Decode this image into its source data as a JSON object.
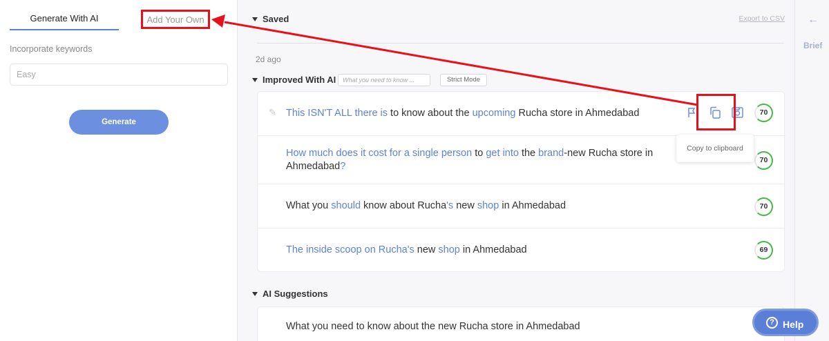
{
  "left_panel": {
    "tabs": [
      {
        "label": "Generate With AI"
      },
      {
        "label": "Add Your Own"
      }
    ],
    "keywords_label": "Incorporate keywords",
    "keywords_placeholder": "Easy",
    "generate_label": "Generate"
  },
  "saved": {
    "heading": "Saved",
    "export_label": "Export to CSV",
    "time_ago": "2d ago"
  },
  "improved": {
    "heading": "Improved With AI",
    "input_placeholder": "What you need to know ...",
    "strict_label": "Strict Mode",
    "rows": [
      {
        "parts": [
          {
            "t": "This ISN'T ALL there is",
            "hl": true
          },
          {
            "t": " to know about the ",
            "hl": false
          },
          {
            "t": "upcoming",
            "hl": true
          },
          {
            "t": " Rucha store in Ahmedabad",
            "hl": false
          }
        ],
        "score": "70"
      },
      {
        "parts": [
          {
            "t": "How much does it cost for a single person",
            "hl": true
          },
          {
            "t": " to ",
            "hl": false
          },
          {
            "t": "get into",
            "hl": true
          },
          {
            "t": " the ",
            "hl": false
          },
          {
            "t": "brand",
            "hl": true
          },
          {
            "t": "-new Rucha store in Ahmedabad",
            "hl": false
          },
          {
            "t": "?",
            "hl": true
          }
        ],
        "score": "70"
      },
      {
        "parts": [
          {
            "t": "What you ",
            "hl": false
          },
          {
            "t": "should",
            "hl": true
          },
          {
            "t": " know about Rucha",
            "hl": false
          },
          {
            "t": "'s",
            "hl": true
          },
          {
            "t": " new ",
            "hl": false
          },
          {
            "t": "shop",
            "hl": true
          },
          {
            "t": " in Ahmedabad",
            "hl": false
          }
        ],
        "score": "70"
      },
      {
        "parts": [
          {
            "t": "The inside scoop on Rucha's",
            "hl": true
          },
          {
            "t": " new ",
            "hl": false
          },
          {
            "t": "shop",
            "hl": true
          },
          {
            "t": " in Ahmedabad",
            "hl": false
          }
        ],
        "score": "69"
      }
    ],
    "tooltip": "Copy to clipboard"
  },
  "suggestions": {
    "heading": "AI Suggestions",
    "first": "What you need to know about the new Rucha store in Ahmedabad"
  },
  "right_panel": {
    "back_icon": "arrow-left-icon",
    "brief_label": "Brief"
  },
  "help": {
    "label": "Help"
  },
  "colors": {
    "accent": "#5f82d3",
    "button": "#6d8fdf",
    "score_ring": "#44b944",
    "annotation_red": "#e8101a"
  }
}
